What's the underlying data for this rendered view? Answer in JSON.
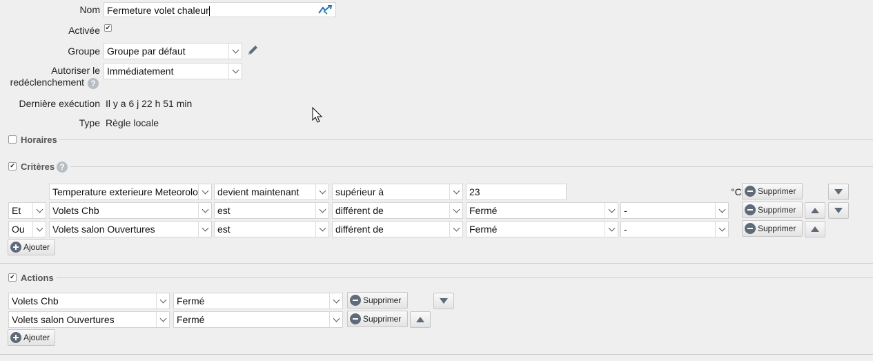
{
  "form": {
    "name_label": "Nom",
    "name_value": "Fermeture volet chaleur",
    "enabled_label": "Activée",
    "group_label": "Groupe",
    "group_value": "Groupe par défaut",
    "retrigger_label_1": "Autoriser le",
    "retrigger_label_2": "redéclenchement",
    "retrigger_value": "Immédiatement",
    "last_run_label": "Dernière exécution",
    "last_run_value": "Il y a 6 j 22 h 51 min",
    "type_label": "Type",
    "type_value": "Règle locale"
  },
  "sections": {
    "schedules": "Horaires",
    "criteria": "Critères",
    "actions": "Actions"
  },
  "criteria": {
    "rows": [
      {
        "logic": "",
        "device": "Temperature exterieure Meteorolog",
        "verb": "devient maintenant",
        "op": "supérieur à",
        "value": "23",
        "unit": "°C"
      },
      {
        "logic": "Et",
        "device": "Volets Chb",
        "verb": "est",
        "op": "différent de",
        "value": "Fermé",
        "extra": "-"
      },
      {
        "logic": "Ou",
        "device": "Volets salon Ouvertures",
        "verb": "est",
        "op": "différent de",
        "value": "Fermé",
        "extra": "-"
      }
    ],
    "delete_label": "Supprimer",
    "add_label": "Ajouter"
  },
  "actions": {
    "rows": [
      {
        "device": "Volets Chb",
        "value": "Fermé"
      },
      {
        "device": "Volets salon Ouvertures",
        "value": "Fermé"
      }
    ],
    "delete_label": "Supprimer",
    "add_label": "Ajouter"
  },
  "icons": {
    "help": "?",
    "accent": "#5f6b79"
  }
}
